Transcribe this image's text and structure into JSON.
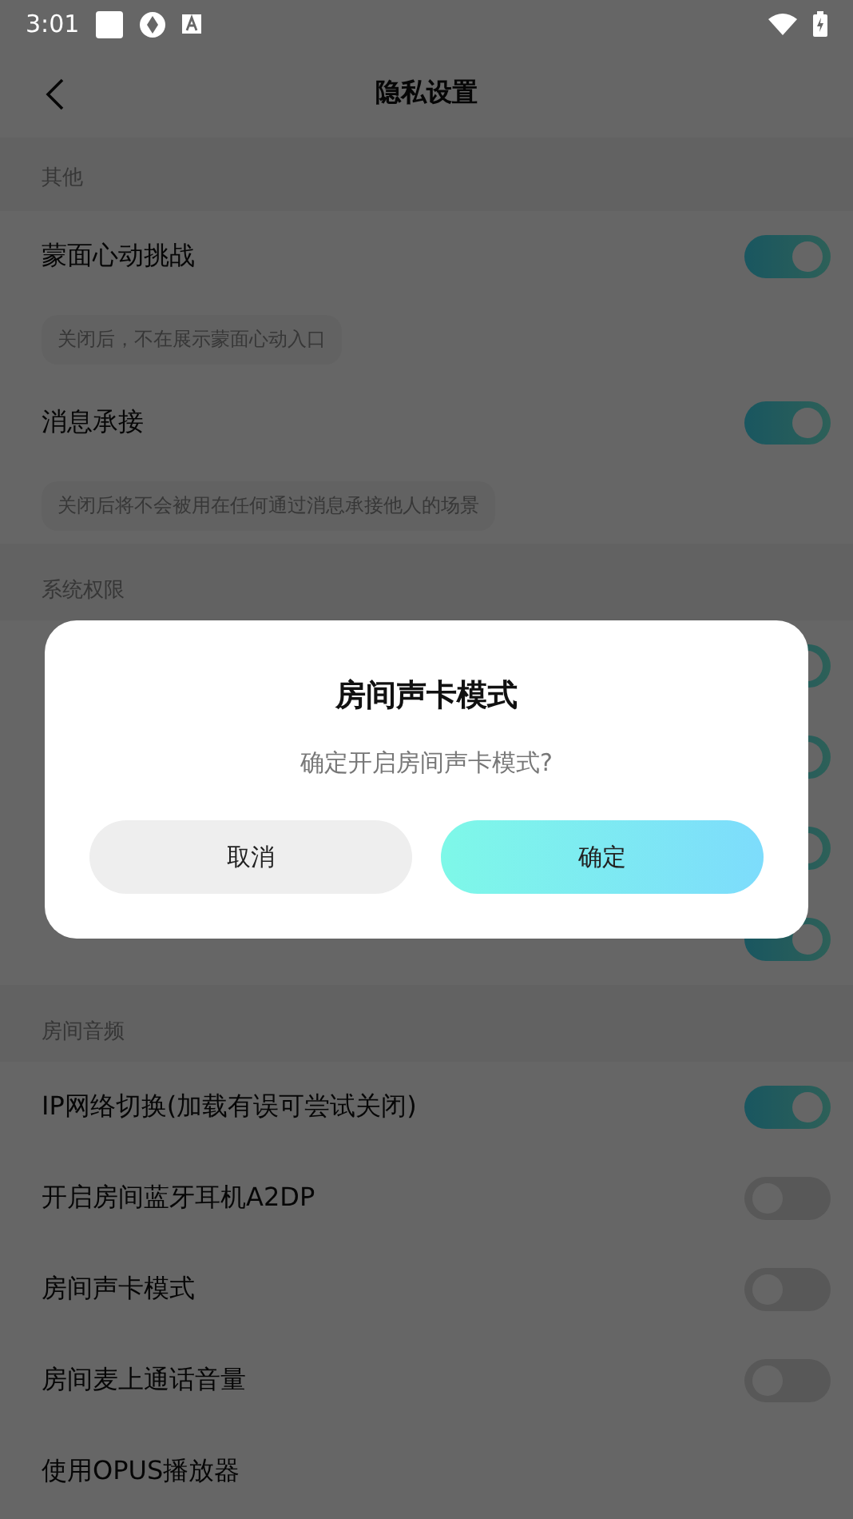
{
  "status_bar": {
    "time": "3:01"
  },
  "header": {
    "title": "隐私设置"
  },
  "sections": [
    {
      "title": "其他",
      "items": [
        {
          "label": "蒙面心动挑战",
          "on": true,
          "hint": "关闭后，不在展示蒙面心动入口"
        },
        {
          "label": "消息承接",
          "on": true,
          "hint": "关闭后将不会被用在任何通过消息承接他人的场景"
        }
      ]
    },
    {
      "title": "系统权限",
      "items": [
        {
          "on": true
        },
        {
          "on": true
        },
        {
          "on": true
        },
        {
          "on": true
        }
      ]
    },
    {
      "title": "房间音频",
      "items": [
        {
          "label": "IP网络切换(加载有误可尝试关闭)",
          "on": true
        },
        {
          "label": "开启房间蓝牙耳机A2DP",
          "on": false
        },
        {
          "label": "房间声卡模式",
          "on": false
        },
        {
          "label": "房间麦上通话音量",
          "on": false
        },
        {
          "label": "使用OPUS播放器"
        }
      ]
    }
  ],
  "dialog": {
    "title": "房间声卡模式",
    "message": "确定开启房间声卡模式?",
    "buttons": [
      {
        "label": "取消",
        "kind": "cancel"
      },
      {
        "label": "确定",
        "kind": "confirm"
      }
    ]
  }
}
